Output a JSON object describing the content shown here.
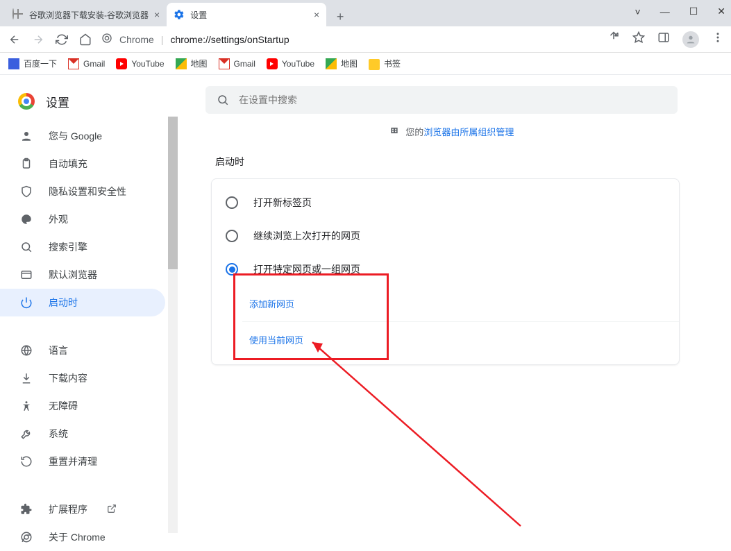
{
  "window_controls": {
    "min": "—",
    "max": "☐",
    "close": "✕",
    "chev": "˅"
  },
  "tabs": [
    {
      "title": "谷歌浏览器下载安装-谷歌浏览器",
      "active": false
    },
    {
      "title": "设置",
      "active": true
    }
  ],
  "new_tab": "+",
  "address": {
    "scheme": "Chrome",
    "url": "chrome://settings/onStartup"
  },
  "bookmarks": [
    {
      "label": "百度一下",
      "icon": "baidu"
    },
    {
      "label": "Gmail",
      "icon": "gmail"
    },
    {
      "label": "YouTube",
      "icon": "youtube"
    },
    {
      "label": "地图",
      "icon": "maps"
    },
    {
      "label": "Gmail",
      "icon": "gmail"
    },
    {
      "label": "YouTube",
      "icon": "youtube"
    },
    {
      "label": "地图",
      "icon": "maps"
    },
    {
      "label": "书签",
      "icon": "folder"
    }
  ],
  "settings_title": "设置",
  "search_placeholder": "在设置中搜索",
  "managed": {
    "prefix": "您的",
    "link": "浏览器由所属组织管理"
  },
  "sidebar": {
    "items": [
      {
        "label": "您与 Google"
      },
      {
        "label": "自动填充"
      },
      {
        "label": "隐私设置和安全性"
      },
      {
        "label": "外观"
      },
      {
        "label": "搜索引擎"
      },
      {
        "label": "默认浏览器"
      },
      {
        "label": "启动时"
      }
    ],
    "items2": [
      {
        "label": "语言"
      },
      {
        "label": "下载内容"
      },
      {
        "label": "无障碍"
      },
      {
        "label": "系统"
      },
      {
        "label": "重置并清理"
      }
    ],
    "items3": [
      {
        "label": "扩展程序"
      },
      {
        "label": "关于 Chrome"
      }
    ]
  },
  "main": {
    "section_title": "启动时",
    "radios": [
      {
        "label": "打开新标签页",
        "selected": false
      },
      {
        "label": "继续浏览上次打开的网页",
        "selected": false
      },
      {
        "label": "打开特定网页或一组网页",
        "selected": true
      }
    ],
    "sublinks": [
      {
        "label": "添加新网页"
      },
      {
        "label": "使用当前网页"
      }
    ]
  }
}
